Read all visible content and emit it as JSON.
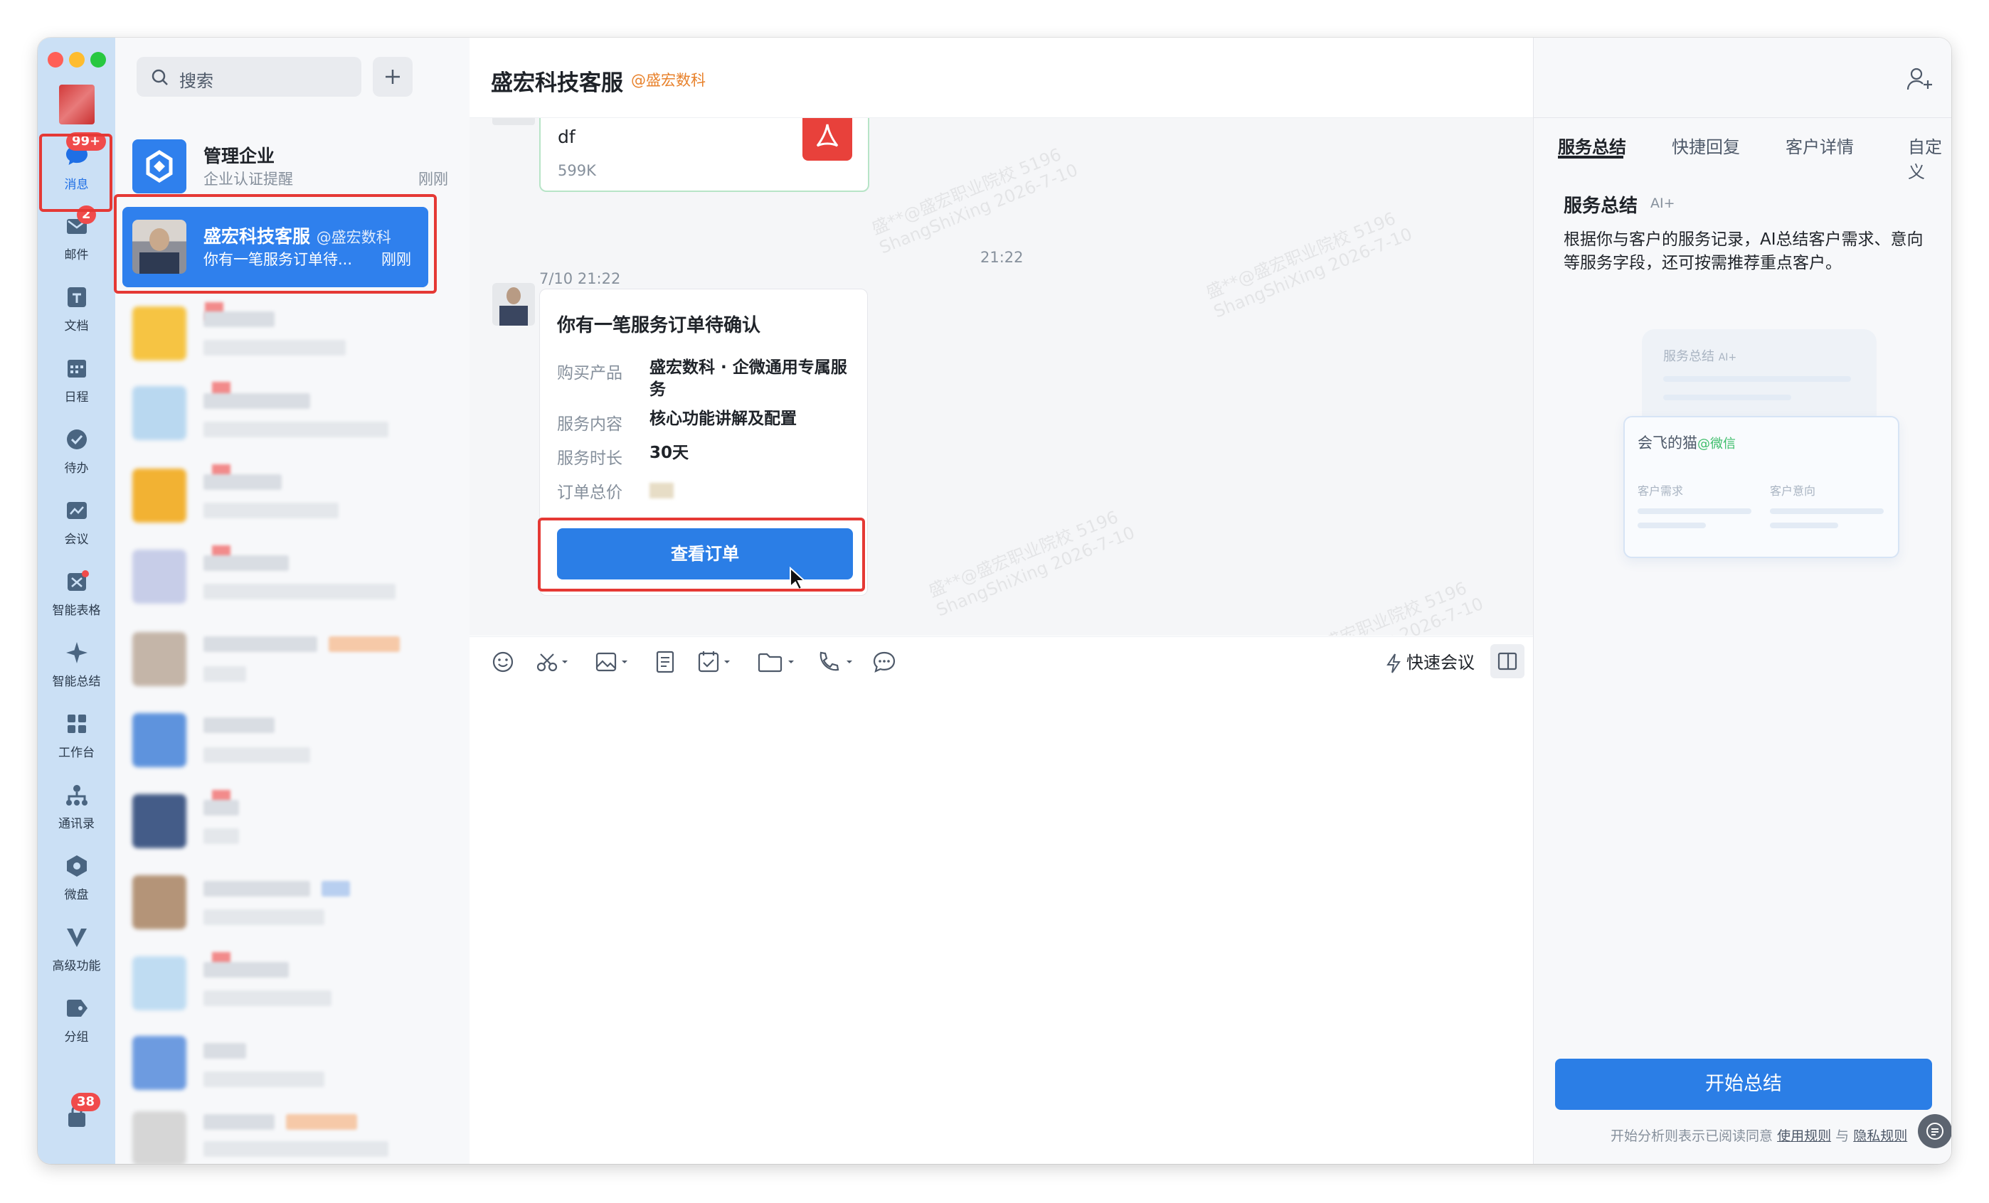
{
  "rail": {
    "items": [
      {
        "label": "消息",
        "badge": "99+"
      },
      {
        "label": "邮件",
        "badge": "2"
      },
      {
        "label": "文档"
      },
      {
        "label": "日程"
      },
      {
        "label": "待办"
      },
      {
        "label": "会议"
      },
      {
        "label": "智能表格"
      },
      {
        "label": "智能总结"
      },
      {
        "label": "工作台"
      },
      {
        "label": "通讯录"
      },
      {
        "label": "微盘"
      },
      {
        "label": "高级功能"
      },
      {
        "label": "分组"
      }
    ],
    "bottom_badge": "38"
  },
  "search": {
    "placeholder": "搜索"
  },
  "conversations": [
    {
      "name": "管理企业",
      "subtitle": "企业认证提醒",
      "time": "刚刚"
    },
    {
      "name": "盛宏科技客服",
      "org": "@盛宏数科",
      "subtitle": "你有一笔服务订单待...",
      "time": "刚刚"
    }
  ],
  "chat": {
    "title": "盛宏科技客服",
    "org": "@盛宏数科",
    "file": {
      "name": "df",
      "size": "599K"
    },
    "center_time": "21:22",
    "msg_time": "7/10 21:22",
    "order": {
      "title": "你有一笔服务订单待确认",
      "rows": [
        {
          "key": "购买产品",
          "value": "盛宏数科 · 企微通用专属服务"
        },
        {
          "key": "服务内容",
          "value": "核心功能讲解及配置"
        },
        {
          "key": "服务时长",
          "value": "30天"
        },
        {
          "key": "订单总价",
          "value": ""
        }
      ],
      "button": "查看订单"
    },
    "quick_meeting": "快速会议",
    "watermark_lines": [
      "盛**@盛宏职业院校 5196",
      "ShangShiXing 2026-7-10"
    ]
  },
  "side": {
    "tabs": [
      "服务总结",
      "快捷回复",
      "客户详情",
      "自定义"
    ],
    "title": "服务总结",
    "ai_tag": "AI+",
    "description": "根据你与客户的服务记录，AI总结客户需求、意向等服务字段，还可按需推荐重点客户。",
    "illustration": {
      "back_title": "服务总结",
      "back_ai": "AI+",
      "card_name": "会飞的猫",
      "card_tag": "@微信",
      "col1": "客户需求",
      "col2": "客户意向"
    },
    "start_button": "开始总结",
    "footer": {
      "prefix": "开始分析则表示已阅读同意",
      "link1": "使用规则",
      "and": "与",
      "link2": "隐私规则"
    }
  },
  "colors": {
    "accent": "#2b7ee6",
    "rail": "#cbe0f5",
    "badge": "#f04b4b",
    "highlight": "#e53935"
  }
}
